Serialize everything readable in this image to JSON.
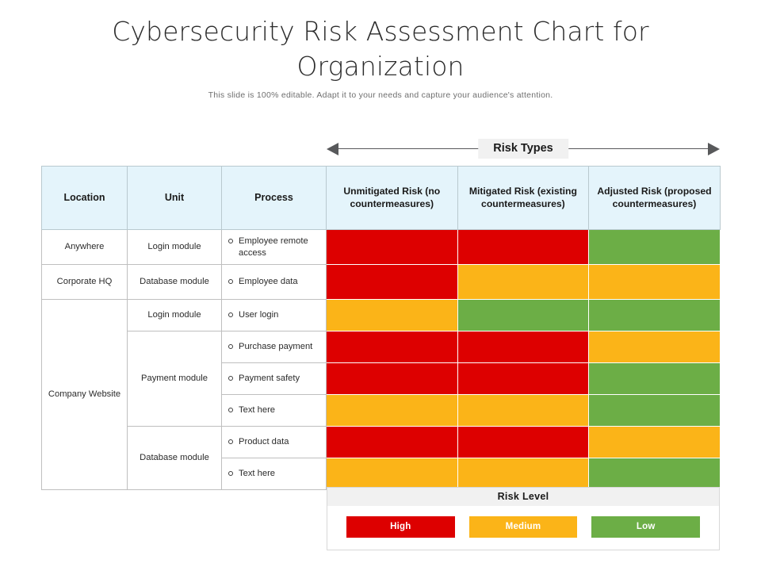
{
  "title": "Cybersecurity Risk Assessment Chart for Organization",
  "subtitle": "This slide is 100% editable. Adapt it to your needs and capture your audience's attention.",
  "risk_types_label": "Risk Types",
  "colors": {
    "high": "#DD0000",
    "medium": "#FBB418",
    "low": "#6CAE46",
    "header_bg": "#E4F4FB",
    "band_bg": "#F1F1F1",
    "border": "#BFBFBF"
  },
  "table": {
    "headers": {
      "location": "Location",
      "unit": "Unit",
      "process": "Process",
      "unmitigated": "Unmitigated Risk (no countermeasures)",
      "mitigated": "Mitigated Risk (existing countermeasures)",
      "adjusted": "Adjusted Risk (proposed countermeasures)"
    },
    "locations": [
      {
        "label": "Anywhere",
        "rowspan": 1
      },
      {
        "label": "Corporate  HQ",
        "rowspan": 1
      },
      {
        "label": "Company Website",
        "rowspan": 6
      }
    ],
    "units": [
      {
        "label": "Login module",
        "rowspan": 1
      },
      {
        "label": "Database module",
        "rowspan": 1
      },
      {
        "label": "Login module",
        "rowspan": 1
      },
      {
        "label": "Payment module",
        "rowspan": 3
      },
      {
        "label": "Database module",
        "rowspan": 2
      }
    ],
    "rows": [
      {
        "process": "Employee remote access",
        "unmitigated": "high",
        "mitigated": "high",
        "adjusted": "low"
      },
      {
        "process": "Employee data",
        "unmitigated": "high",
        "mitigated": "medium",
        "adjusted": "medium"
      },
      {
        "process": "User login",
        "unmitigated": "medium",
        "mitigated": "low",
        "adjusted": "low"
      },
      {
        "process": "Purchase payment",
        "unmitigated": "high",
        "mitigated": "high",
        "adjusted": "medium"
      },
      {
        "process": "Payment safety",
        "unmitigated": "high",
        "mitigated": "high",
        "adjusted": "low"
      },
      {
        "process": "Text here",
        "unmitigated": "medium",
        "mitigated": "medium",
        "adjusted": "low"
      },
      {
        "process": "Product data",
        "unmitigated": "high",
        "mitigated": "high",
        "adjusted": "medium"
      },
      {
        "process": "Text here",
        "unmitigated": "medium",
        "mitigated": "medium",
        "adjusted": "low"
      }
    ]
  },
  "legend": {
    "title": "Risk Level",
    "items": [
      {
        "label": "High",
        "level": "high"
      },
      {
        "label": "Medium",
        "level": "medium"
      },
      {
        "label": "Low",
        "level": "low"
      }
    ]
  },
  "chart_data": {
    "type": "heatmap",
    "title": "Cybersecurity Risk Assessment Chart for Organization",
    "xlabel": "Risk Types",
    "ylabel": "Location / Unit / Process",
    "categories": [
      "Unmitigated Risk (no countermeasures)",
      "Mitigated Risk (existing countermeasures)",
      "Adjusted Risk (proposed countermeasures)"
    ],
    "rows": [
      "Anywhere / Login module / Employee remote access",
      "Corporate HQ / Database module / Employee data",
      "Company Website / Login module / User login",
      "Company Website / Payment module / Purchase payment",
      "Company Website / Payment module / Payment safety",
      "Company Website / Payment module / Text here",
      "Company Website / Database module / Product data",
      "Company Website / Database module / Text here"
    ],
    "values": [
      [
        "high",
        "high",
        "low"
      ],
      [
        "high",
        "medium",
        "medium"
      ],
      [
        "medium",
        "low",
        "low"
      ],
      [
        "high",
        "high",
        "medium"
      ],
      [
        "high",
        "high",
        "low"
      ],
      [
        "medium",
        "medium",
        "low"
      ],
      [
        "high",
        "high",
        "medium"
      ],
      [
        "medium",
        "medium",
        "low"
      ]
    ],
    "scale": {
      "high": "#DD0000",
      "medium": "#FBB418",
      "low": "#6CAE46"
    },
    "legend_position": "bottom-right",
    "grid": true
  }
}
